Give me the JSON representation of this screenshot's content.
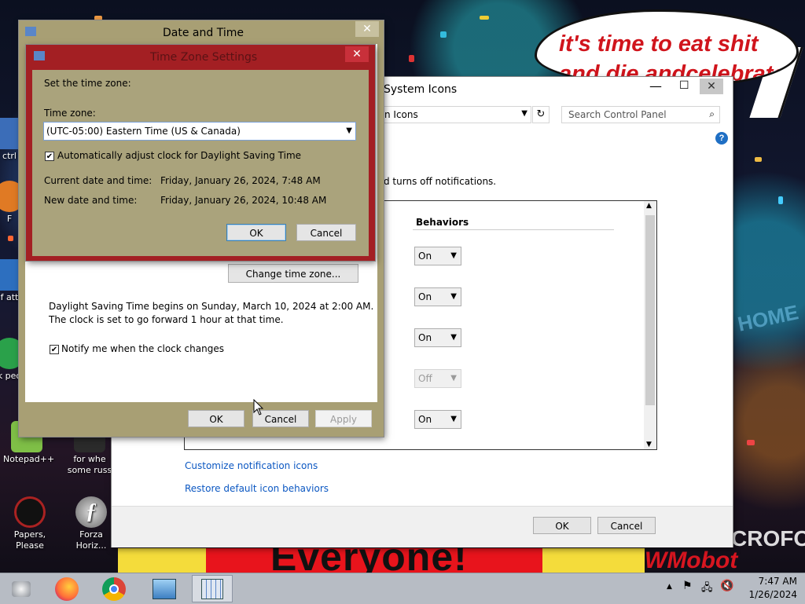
{
  "desktop": {
    "speech_bubble": "it's time to eat shit\nand die andcelebrate",
    "banner_text": "Everyone!",
    "watermark": "WMobot",
    "icons": [
      {
        "label": "ctrl"
      },
      {
        "label": "F"
      },
      {
        "label": "f att"
      },
      {
        "label": "k peo"
      },
      {
        "label": "Notepad++"
      },
      {
        "label": "for whe some russ"
      },
      {
        "label": "Papers, Please"
      },
      {
        "label": "Forza Horiz..."
      }
    ]
  },
  "control_panel": {
    "title": "System Icons",
    "address": "n Icons",
    "search_placeholder": "Search Control Panel",
    "description": "d turns off notifications.",
    "column_header": "Behaviors",
    "behaviors": [
      "On",
      "On",
      "On",
      "Off",
      "On"
    ],
    "links": [
      "Customize notification icons",
      "Restore default icon behaviors"
    ],
    "ok_label": "OK",
    "cancel_label": "Cancel"
  },
  "date_time": {
    "title": "Date and Time",
    "change_tz_button": "Change time zone...",
    "dst_line1": "Daylight Saving Time begins on Sunday, March 10, 2024 at 2:00 AM.",
    "dst_line2": "The clock is set to go forward 1 hour at that time.",
    "notify_label": "Notify me when the clock changes",
    "ok_label": "OK",
    "cancel_label": "Cancel",
    "apply_label": "Apply"
  },
  "tz_dialog": {
    "title": "Time Zone Settings",
    "set_label": "Set the time zone:",
    "tz_label": "Time zone:",
    "tz_value": "(UTC-05:00) Eastern Time (US & Canada)",
    "dst_auto_label": "Automatically adjust clock for Daylight Saving Time",
    "current_label": "Current date and time:",
    "current_value": "Friday, January 26, 2024, 7:48 AM",
    "new_label": "New date and time:",
    "new_value": "Friday, January 26, 2024, 10:48 AM",
    "ok_label": "OK",
    "cancel_label": "Cancel"
  },
  "taskbar": {
    "time": "7:47 AM",
    "date": "1/26/2024"
  }
}
